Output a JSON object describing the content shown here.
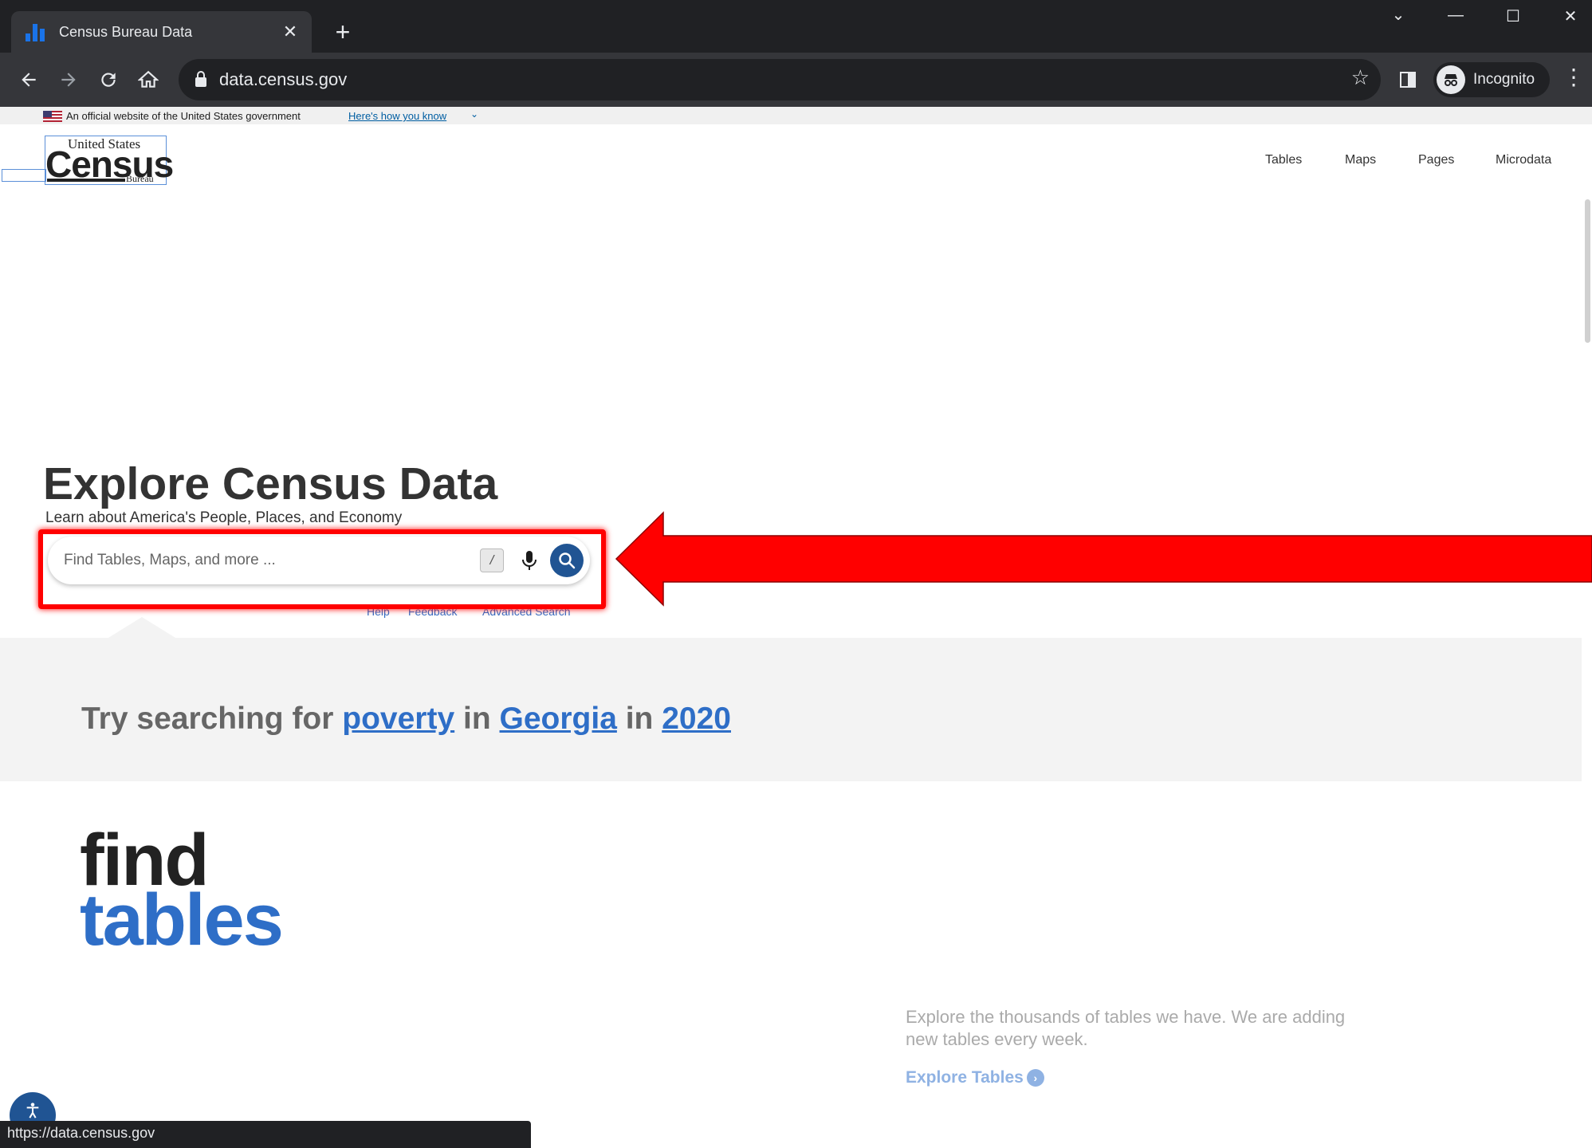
{
  "browser": {
    "tab_title": "Census Bureau Data",
    "new_tab_label": "+",
    "close_tab_label": "✕",
    "url": "data.census.gov",
    "profile_label": "Incognito",
    "window_controls": {
      "dropdown": "⌄",
      "minimize": "—",
      "maximize": "☐",
      "close": "✕"
    },
    "status_url": "https://data.census.gov"
  },
  "gov_banner": {
    "text": "An official website of the United States government",
    "link": "Here's how you know",
    "chevron": "⌄"
  },
  "logo": {
    "top": "United States",
    "main": "Census",
    "bottom": "Bureau"
  },
  "nav": {
    "items": [
      "Tables",
      "Maps",
      "Pages",
      "Microdata"
    ]
  },
  "hero": {
    "title": "Explore Census Data",
    "subtitle": "Learn about America's People, Places, and Economy"
  },
  "search": {
    "placeholder": "Find Tables, Maps, and more ...",
    "shortcut_key": "/",
    "links": [
      "Help",
      "Feedback",
      "Advanced Search"
    ]
  },
  "try_searching": {
    "prefix": "Try searching for ",
    "topic": "poverty",
    "in1": " in ",
    "geo": "Georgia",
    "in2": " in ",
    "year": "2020"
  },
  "find_tables": {
    "line1": "find",
    "line2": "tables",
    "description": "Explore the thousands of tables we have. We are adding new tables every week.",
    "link": "Explore Tables"
  },
  "colors": {
    "chrome_dark": "#202124",
    "chrome_toolbar": "#35363a",
    "census_blue": "#2e6ec7",
    "search_button": "#205493",
    "annotation_red": "#ff0000"
  }
}
